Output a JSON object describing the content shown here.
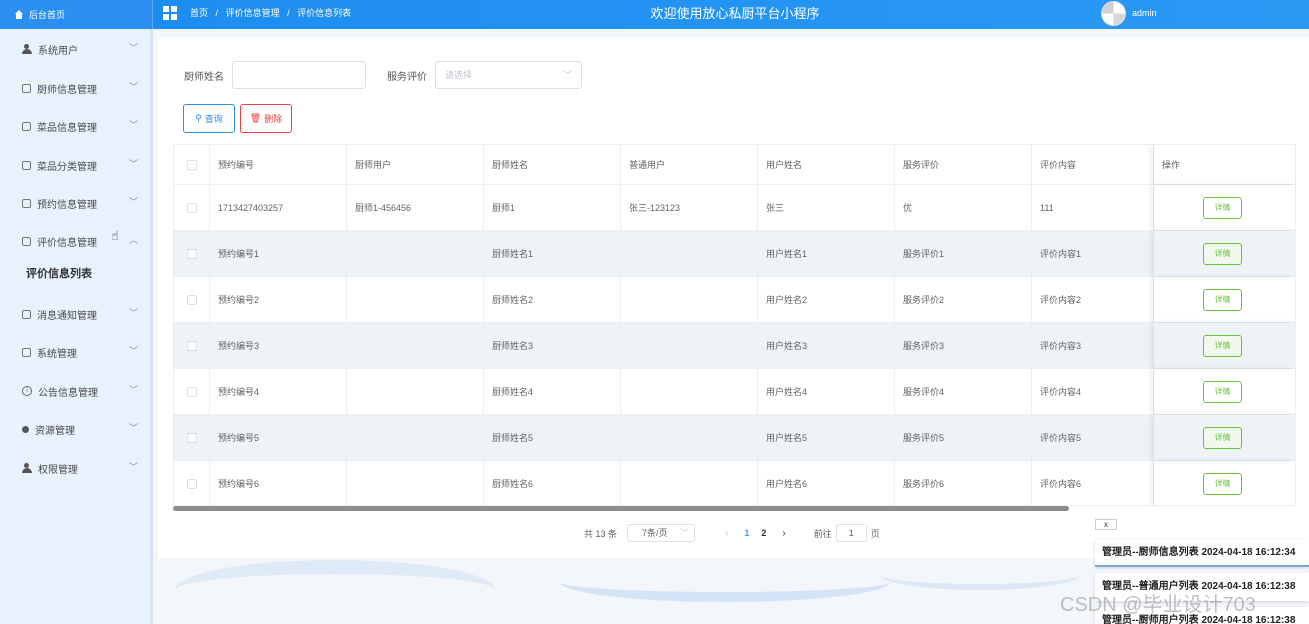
{
  "header": {
    "brand": "后台首页",
    "breadcrumbs": [
      "首页",
      "/",
      "评价信息管理",
      "/",
      "评价信息列表"
    ],
    "app_title": "欢迎使用放心私厨平台小程序",
    "username": "admin"
  },
  "sidebar": {
    "items": [
      {
        "label": "系统用户",
        "icon": "user-icon"
      },
      {
        "label": "厨师信息管理",
        "icon": "box-icon"
      },
      {
        "label": "菜品信息管理",
        "icon": "box-icon"
      },
      {
        "label": "菜品分类管理",
        "icon": "box-icon"
      },
      {
        "label": "预约信息管理",
        "icon": "box-icon"
      },
      {
        "label": "评价信息管理",
        "icon": "box-icon",
        "expanded": true
      },
      {
        "label": "消息通知管理",
        "icon": "box-icon"
      },
      {
        "label": "系统管理",
        "icon": "image-icon"
      },
      {
        "label": "公告信息管理",
        "icon": "info-icon"
      },
      {
        "label": "资源管理",
        "icon": "dot-icon"
      },
      {
        "label": "权限管理",
        "icon": "user-icon"
      }
    ],
    "active_submenu": "评价信息列表"
  },
  "search": {
    "chef_name_label": "厨师姓名",
    "chef_name_value": "",
    "rating_label": "服务评价",
    "rating_placeholder": "请选择",
    "query_button": "查询",
    "delete_button": "删除"
  },
  "table": {
    "columns": [
      "预约编号",
      "厨师用户",
      "厨师姓名",
      "普通用户",
      "用户姓名",
      "服务评价",
      "评价内容",
      "操作"
    ],
    "detail_label": "详情",
    "rows": [
      [
        "1713427403257",
        "厨师1-456456",
        "厨师1",
        "张三-123123",
        "张三",
        "优",
        "111"
      ],
      [
        "预约编号1",
        "",
        "厨师姓名1",
        "",
        "用户姓名1",
        "服务评价1",
        "评价内容1"
      ],
      [
        "预约编号2",
        "",
        "厨师姓名2",
        "",
        "用户姓名2",
        "服务评价2",
        "评价内容2"
      ],
      [
        "预约编号3",
        "",
        "厨师姓名3",
        "",
        "用户姓名3",
        "服务评价3",
        "评价内容3"
      ],
      [
        "预约编号4",
        "",
        "厨师姓名4",
        "",
        "用户姓名4",
        "服务评价4",
        "评价内容4"
      ],
      [
        "预约编号5",
        "",
        "厨师姓名5",
        "",
        "用户姓名5",
        "服务评价5",
        "评价内容5"
      ],
      [
        "预约编号6",
        "",
        "厨师姓名6",
        "",
        "用户姓名6",
        "服务评价6",
        "评价内容6"
      ]
    ]
  },
  "pagination": {
    "total": "共 13 条",
    "page_size": "7条/页",
    "pages": [
      "1",
      "2"
    ],
    "current_page": "1",
    "goto_label": "前往",
    "goto_value": "1",
    "page_suffix": "页"
  },
  "notifications": {
    "close_label": "x",
    "items": [
      "管理员--厨师信息列表 2024-04-18 16:12:34",
      "管理员--普通用户列表 2024-04-18 16:12:38",
      "管理员--厨师用户列表 2024-04-18 16:12:38"
    ]
  },
  "watermark": "CSDN @毕业设计703",
  "colors": {
    "header_blue": "#1b8cf0",
    "sidebar_bg": "#e8f2fd",
    "primary": "#2d8cf0",
    "danger": "#e64242",
    "success": "#67c23a"
  }
}
